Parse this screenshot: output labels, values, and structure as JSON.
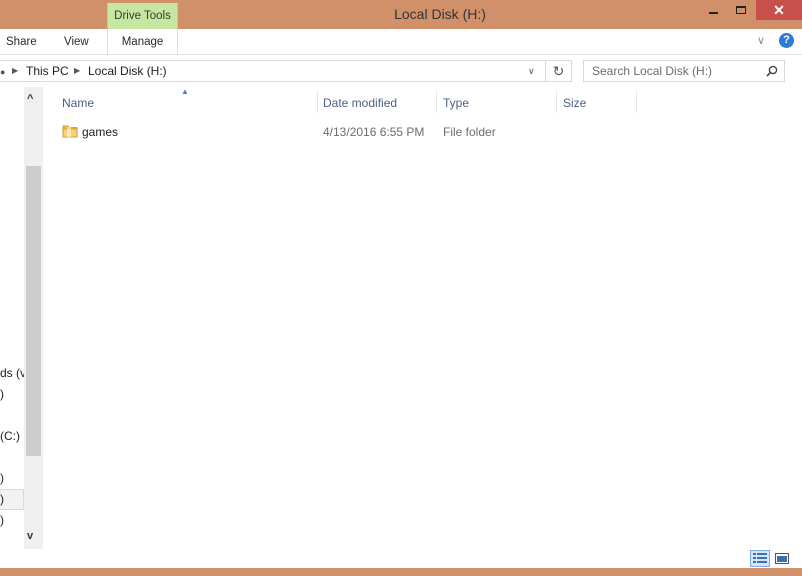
{
  "window": {
    "title": "Local Disk (H:)",
    "context_tab": "Drive Tools",
    "close_glyph": "✕",
    "accent_color": "#d0906a",
    "close_color": "#c7504d",
    "context_tab_color": "#c6e7a0"
  },
  "ribbon": {
    "tabs": [
      "Share",
      "View",
      "Manage"
    ],
    "collapse_glyph": "∨",
    "help_glyph": "?"
  },
  "address": {
    "crumbs": [
      "This PC",
      "Local Disk (H:)"
    ],
    "refresh_glyph": "↻",
    "search_placeholder": "Search Local Disk (H:)"
  },
  "nav_pane": {
    "visible_fragments": [
      "ds (va",
      ")",
      "(C:)",
      ")",
      ")",
      ")"
    ],
    "scroll_up": "^",
    "scroll_down": "v"
  },
  "columns": [
    "Name",
    "Date modified",
    "Type",
    "Size"
  ],
  "files": [
    {
      "name": "games",
      "date_modified": "4/13/2016 6:55 PM",
      "type": "File folder",
      "size": "",
      "icon": "folder-icon"
    }
  ],
  "view_buttons": [
    "details-view-icon",
    "large-icons-view-icon"
  ]
}
